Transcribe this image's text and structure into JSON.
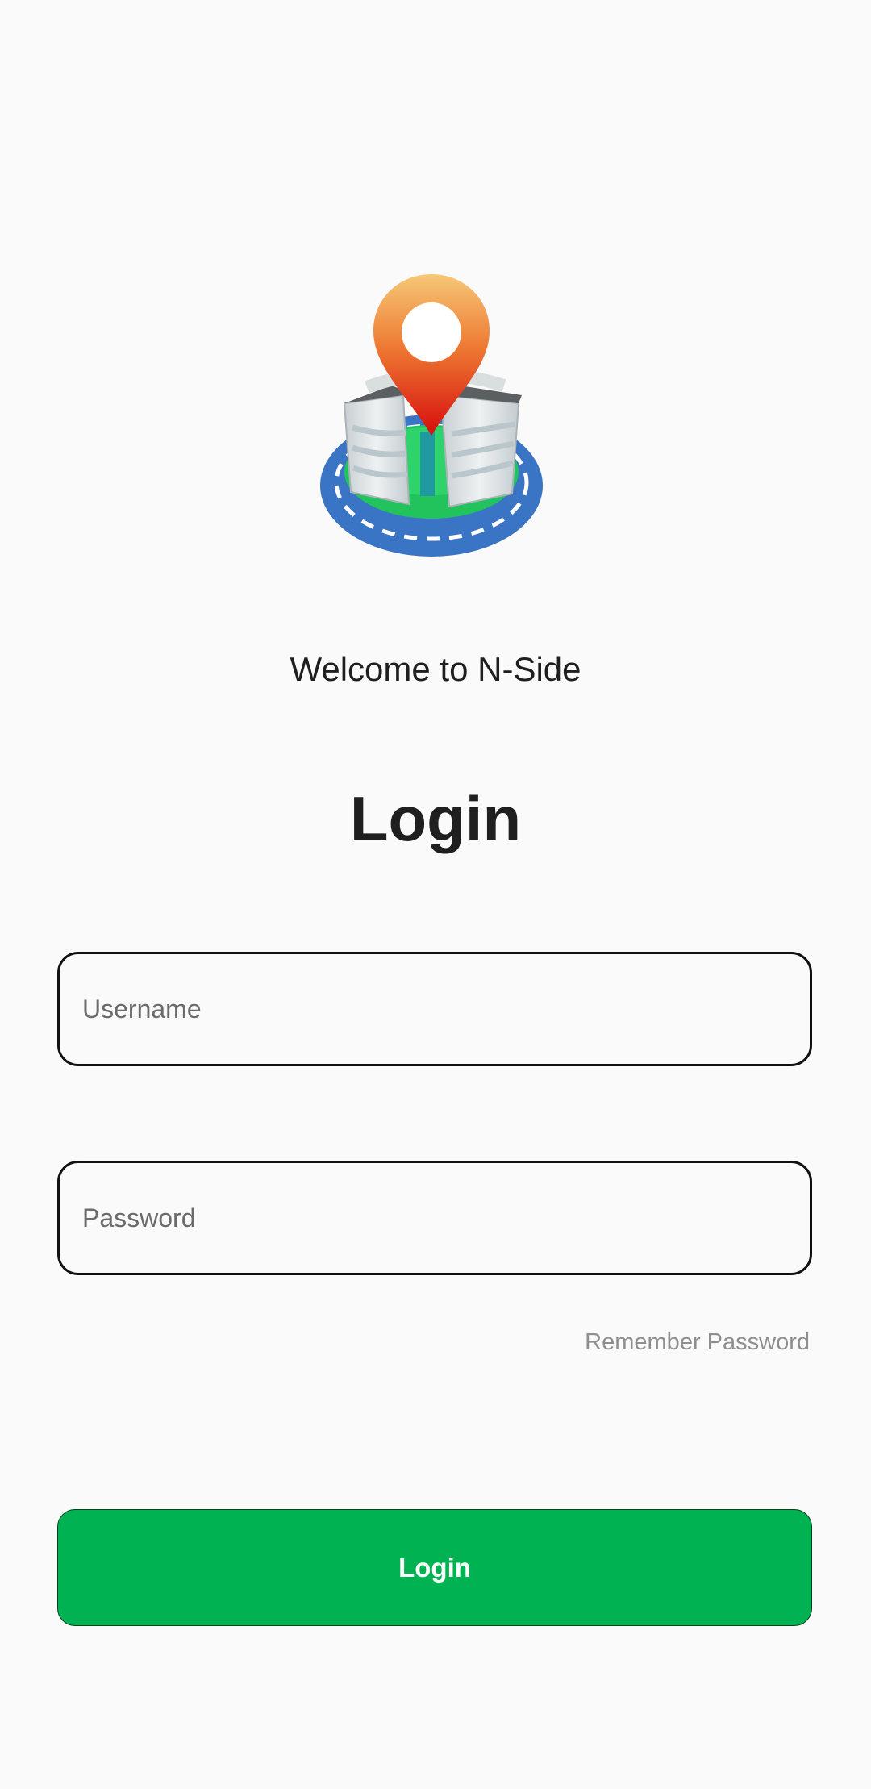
{
  "welcome_text": "Welcome to N-Side",
  "title": "Login",
  "username": {
    "placeholder": "Username",
    "value": ""
  },
  "password": {
    "placeholder": "Password",
    "value": ""
  },
  "remember_label": "Remember Password",
  "login_button_label": "Login",
  "colors": {
    "background": "#fafafa",
    "primary": "#00b251",
    "field_border": "#111111",
    "muted_text": "#8e8e8e"
  },
  "logo_icon": "map-pin-building-icon"
}
